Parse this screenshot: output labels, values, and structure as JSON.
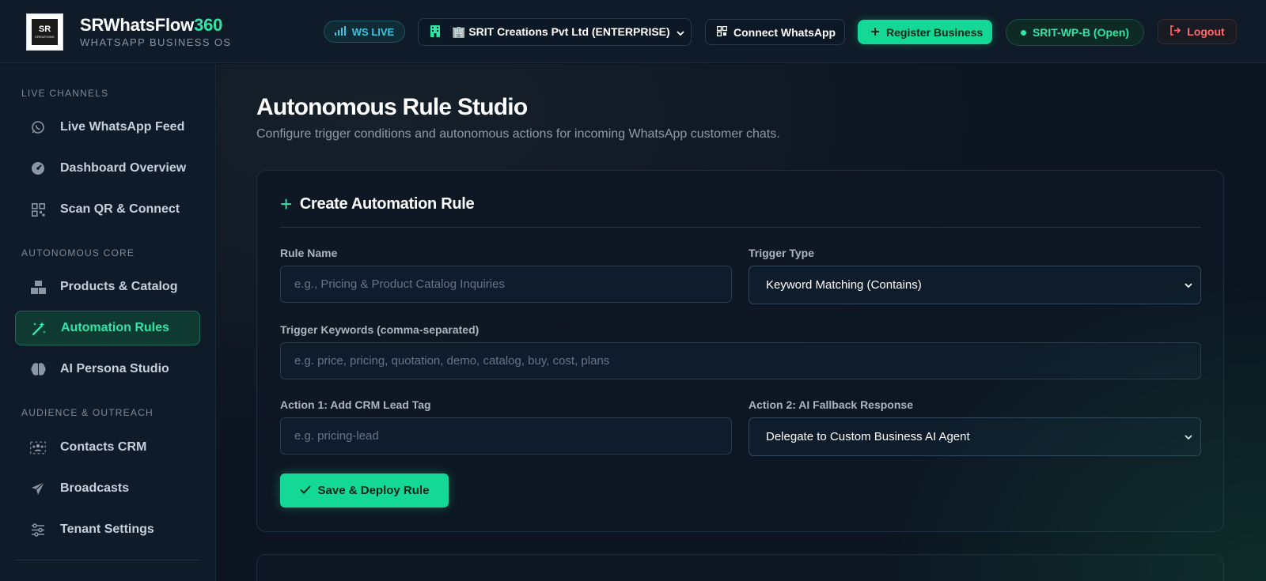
{
  "brand": {
    "title_main": "SRWhatsFlow",
    "title_accent": "360",
    "subtitle": "WHATSAPP BUSINESS OS",
    "logo_text": "SR",
    "logo_small": "CREATIONS"
  },
  "header": {
    "ws_status": "WS LIVE",
    "tenant": "🏢 SRIT Creations Pvt Ltd (ENTERPRISE)",
    "connect_label": "Connect WhatsApp",
    "register_label": "Register Business",
    "instance_label": "SRIT-WP-B (Open)",
    "logout_label": "Logout"
  },
  "sidebar": {
    "sections": [
      {
        "label": "LIVE CHANNELS",
        "items": [
          {
            "label": "Live WhatsApp Feed",
            "icon": "whatsapp-icon"
          },
          {
            "label": "Dashboard Overview",
            "icon": "gauge-icon"
          },
          {
            "label": "Scan QR & Connect",
            "icon": "qr-icon"
          }
        ]
      },
      {
        "label": "AUTONOMOUS CORE",
        "items": [
          {
            "label": "Products & Catalog",
            "icon": "boxes-icon"
          },
          {
            "label": "Automation Rules",
            "icon": "magic-wand-icon",
            "active": true
          },
          {
            "label": "AI Persona Studio",
            "icon": "brain-icon"
          }
        ]
      },
      {
        "label": "AUDIENCE & OUTREACH",
        "items": [
          {
            "label": "Contacts CRM",
            "icon": "users-icon"
          },
          {
            "label": "Broadcasts",
            "icon": "paper-plane-icon"
          },
          {
            "label": "Tenant Settings",
            "icon": "sliders-icon"
          }
        ]
      }
    ]
  },
  "main": {
    "title": "Autonomous Rule Studio",
    "subtitle": "Configure trigger conditions and autonomous actions for incoming WhatsApp customer chats.",
    "card": {
      "title": "Create Automation Rule",
      "rule_name_label": "Rule Name",
      "rule_name_placeholder": "e.g., Pricing & Product Catalog Inquiries",
      "rule_name_value": "",
      "trigger_type_label": "Trigger Type",
      "trigger_type_value": "Keyword Matching (Contains)",
      "keywords_label": "Trigger Keywords (comma-separated)",
      "keywords_placeholder": "e.g. price, pricing, quotation, demo, catalog, buy, cost, plans",
      "crm_tag_label": "Action 1: Add CRM Lead Tag",
      "crm_tag_placeholder": "e.g. pricing-lead",
      "fallback_label": "Action 2: AI Fallback Response",
      "fallback_value": "Delegate to Custom Business AI Agent",
      "save_label": "Save & Deploy Rule"
    }
  },
  "colors": {
    "accent": "#13d896",
    "accent_text": "#2ee6a6",
    "danger": "#ff6b6b",
    "info": "#38c6e0",
    "background": "#0b1420"
  }
}
